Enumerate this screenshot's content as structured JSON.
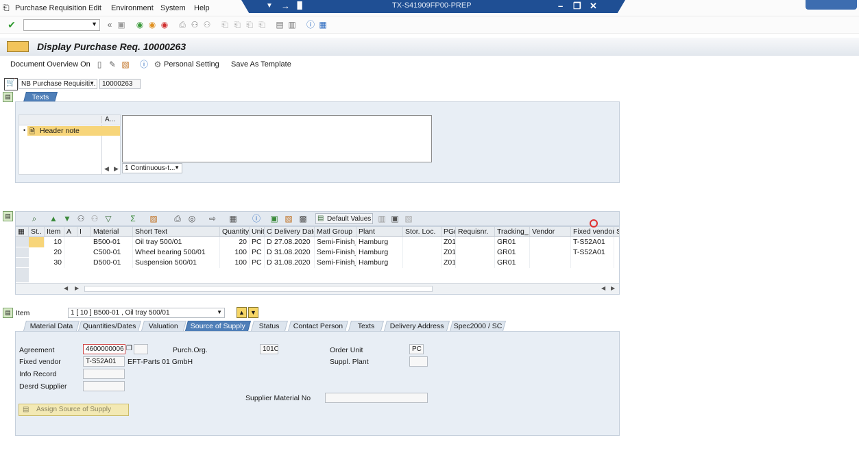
{
  "window": {
    "title": "TX-S41909FP00-PREP"
  },
  "menu": [
    "Purchase Requisition",
    "Edit",
    "Environment",
    "System",
    "Help"
  ],
  "toolbar": {
    "command_value": ""
  },
  "page": {
    "title": "Display Purchase Req. 10000263"
  },
  "app_toolbar": {
    "doc_overview": "Document Overview On",
    "personal_setting": "Personal Setting",
    "save_template": "Save As Template"
  },
  "header": {
    "doc_type": "NB Purchase Requisiti...",
    "doc_number": "10000263",
    "tab_texts": "Texts",
    "tree_col": "A...",
    "tree_item": "Header note",
    "text_format": "1 Continuous-t..."
  },
  "grid": {
    "default_values": "Default Values",
    "columns": [
      "St..",
      "Item",
      "A",
      "I",
      "Material",
      "Short Text",
      "Quantity",
      "Unit",
      "C",
      "Delivery Date",
      "Matl Group",
      "Plant",
      "Stor. Loc.",
      "PGr",
      "Requisnr.",
      "Tracking_",
      "Vendor",
      "Fixed vendor",
      "S"
    ],
    "rows": [
      {
        "item": "10",
        "material": "B500-01",
        "short": "Oil tray 500/01",
        "qty": "20",
        "unit": "PC",
        "c": "D",
        "date": "27.08.2020",
        "mg": "Semi-Finish_",
        "plant": "Hamburg",
        "sloc": "",
        "pgr": "Z01",
        "req": "",
        "track": "GR01",
        "vendor": "",
        "fixed": "T-S52A01"
      },
      {
        "item": "20",
        "material": "C500-01",
        "short": "Wheel bearing 500/01",
        "qty": "100",
        "unit": "PC",
        "c": "D",
        "date": "31.08.2020",
        "mg": "Semi-Finish_",
        "plant": "Hamburg",
        "sloc": "",
        "pgr": "Z01",
        "req": "",
        "track": "GR01",
        "vendor": "",
        "fixed": "T-S52A01"
      },
      {
        "item": "30",
        "material": "D500-01",
        "short": "Suspension 500/01",
        "qty": "100",
        "unit": "PC",
        "c": "D",
        "date": "31.08.2020",
        "mg": "Semi-Finish_",
        "plant": "Hamburg",
        "sloc": "",
        "pgr": "Z01",
        "req": "",
        "track": "GR01",
        "vendor": "",
        "fixed": ""
      }
    ]
  },
  "item_detail": {
    "label": "Item",
    "selector": "1 [ 10 ] B500-01 , Oil tray 500/01",
    "tabs": [
      "Material Data",
      "Quantities/Dates",
      "Valuation",
      "Source of Supply",
      "Status",
      "Contact Person",
      "Texts",
      "Delivery Address",
      "Spec2000 / SC"
    ],
    "active_tab": "Source of Supply",
    "agreement_label": "Agreement",
    "agreement_value": "4600000006",
    "fixed_vendor_label": "Fixed vendor",
    "fixed_vendor_value": "T-S52A01",
    "fixed_vendor_name": "EFT-Parts 01 GmbH",
    "info_record_label": "Info Record",
    "desired_supplier_label": "Desrd Supplier",
    "purch_org_label": "Purch.Org.",
    "purch_org_value": "101C",
    "order_unit_label": "Order Unit",
    "order_unit_value": "PC",
    "suppl_plant_label": "Suppl. Plant",
    "supplier_material_label": "Supplier Material No",
    "assign_button": "Assign Source of Supply"
  }
}
